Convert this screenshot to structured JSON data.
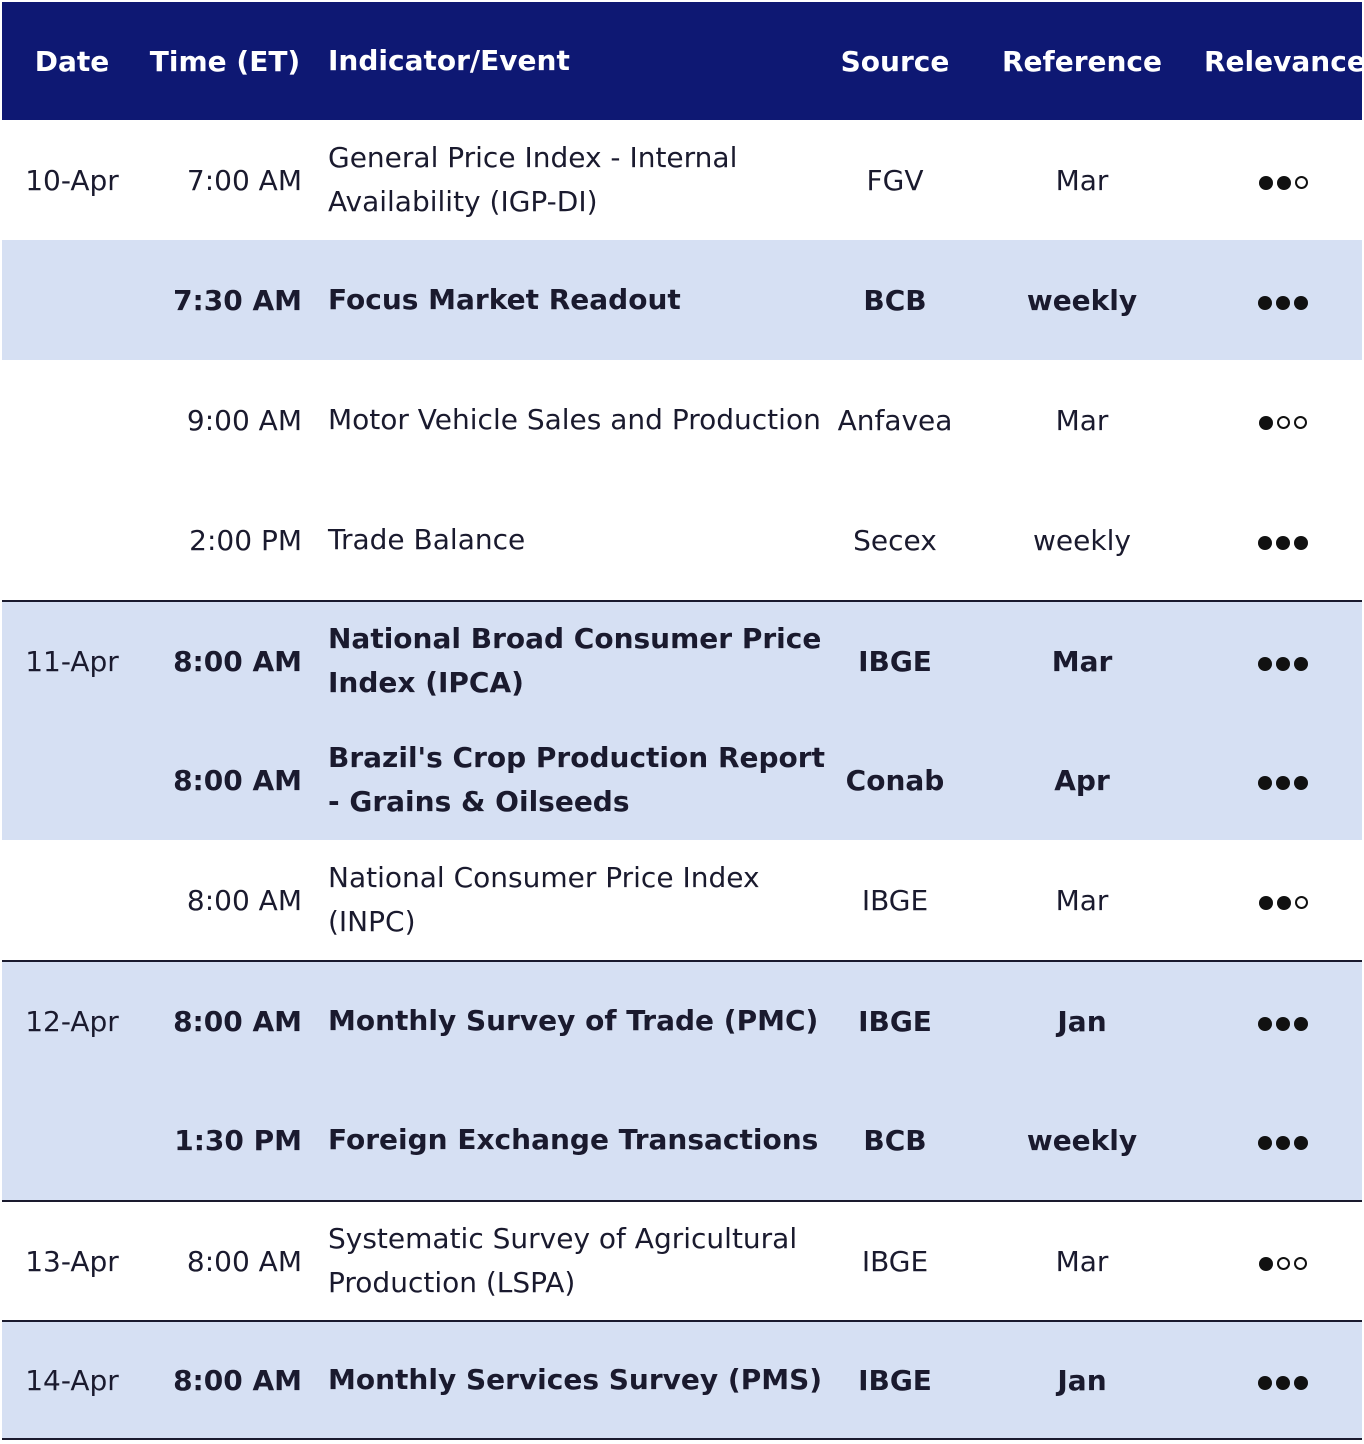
{
  "headers": {
    "date": "Date",
    "time": "Time (ET)",
    "indicator": "Indicator/Event",
    "source": "Source",
    "reference": "Reference",
    "relevance": "Relevance"
  },
  "rows": [
    {
      "date": "10-Apr",
      "time": "7:00 AM",
      "indicator": "General Price Index - Internal Availability (IGP-DI)",
      "source": "FGV",
      "reference": "Mar",
      "relevance": 2
    },
    {
      "date": "",
      "time": "7:30 AM",
      "indicator": "Focus Market Readout",
      "source": "BCB",
      "reference": "weekly",
      "relevance": 3
    },
    {
      "date": "",
      "time": "9:00 AM",
      "indicator": "Motor Vehicle Sales and Production",
      "source": "Anfavea",
      "reference": "Mar",
      "relevance": 1
    },
    {
      "date": "",
      "time": "2:00 PM",
      "indicator": "Trade Balance",
      "source": "Secex",
      "reference": "weekly",
      "relevance": 3
    },
    {
      "date": "11-Apr",
      "time": "8:00 AM",
      "indicator": "National Broad Consumer Price Index (IPCA)",
      "source": "IBGE",
      "reference": "Mar",
      "relevance": 3
    },
    {
      "date": "",
      "time": "8:00 AM",
      "indicator": "Brazil's Crop Production Report - Grains & Oilseeds",
      "source": "Conab",
      "reference": "Apr",
      "relevance": 3
    },
    {
      "date": "",
      "time": "8:00 AM",
      "indicator": "National Consumer Price Index (INPC)",
      "source": "IBGE",
      "reference": "Mar",
      "relevance": 2
    },
    {
      "date": "12-Apr",
      "time": "8:00 AM",
      "indicator": "Monthly Survey of Trade (PMC)",
      "source": "IBGE",
      "reference": "Jan",
      "relevance": 3
    },
    {
      "date": "",
      "time": "1:30 PM",
      "indicator": "Foreign Exchange Transactions",
      "source": "BCB",
      "reference": "weekly",
      "relevance": 3
    },
    {
      "date": "13-Apr",
      "time": "8:00 AM",
      "indicator": "Systematic Survey of Agricultural Production (LSPA)",
      "source": "IBGE",
      "reference": "Mar",
      "relevance": 1
    },
    {
      "date": "14-Apr",
      "time": "8:00 AM",
      "indicator": "Monthly Services Survey (PMS)",
      "source": "IBGE",
      "reference": "Jan",
      "relevance": 3
    }
  ]
}
